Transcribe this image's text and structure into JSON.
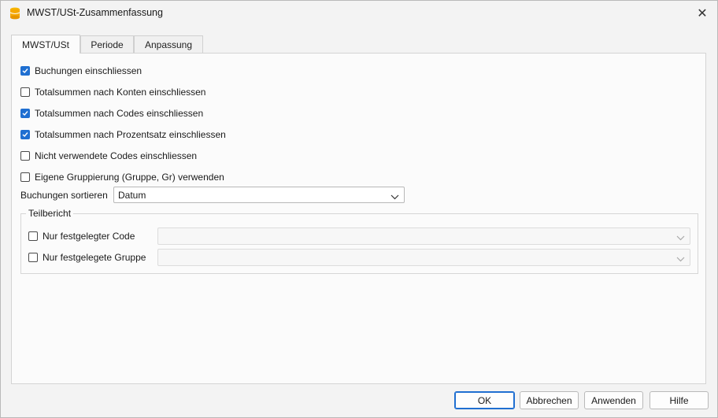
{
  "window": {
    "title": "MWST/USt-Zusammenfassung",
    "close_glyph": "✕",
    "icon": "app-stack-icon",
    "accent": "#1f6fd1"
  },
  "tabs": [
    {
      "label": "MWST/USt",
      "active": true
    },
    {
      "label": "Periode",
      "active": false
    },
    {
      "label": "Anpassung",
      "active": false
    }
  ],
  "options": [
    {
      "label": "Buchungen einschliessen",
      "checked": true
    },
    {
      "label": "Totalsummen nach Konten einschliessen",
      "checked": false
    },
    {
      "label": "Totalsummen nach Codes einschliessen",
      "checked": true
    },
    {
      "label": "Totalsummen nach Prozentsatz einschliessen",
      "checked": true
    },
    {
      "label": "Nicht verwendete Codes einschliessen",
      "checked": false
    },
    {
      "label": "Eigene Gruppierung (Gruppe, Gr) verwenden",
      "checked": false
    }
  ],
  "sort": {
    "label": "Buchungen sortieren",
    "value": "Datum"
  },
  "partial_report": {
    "title": "Teilbericht",
    "code": {
      "label": "Nur festgelegter Code",
      "checked": false,
      "value": ""
    },
    "group": {
      "label": "Nur festgelegete Gruppe",
      "checked": false,
      "value": ""
    }
  },
  "buttons": {
    "ok": "OK",
    "cancel": "Abbrechen",
    "apply": "Anwenden",
    "help": "Hilfe"
  }
}
